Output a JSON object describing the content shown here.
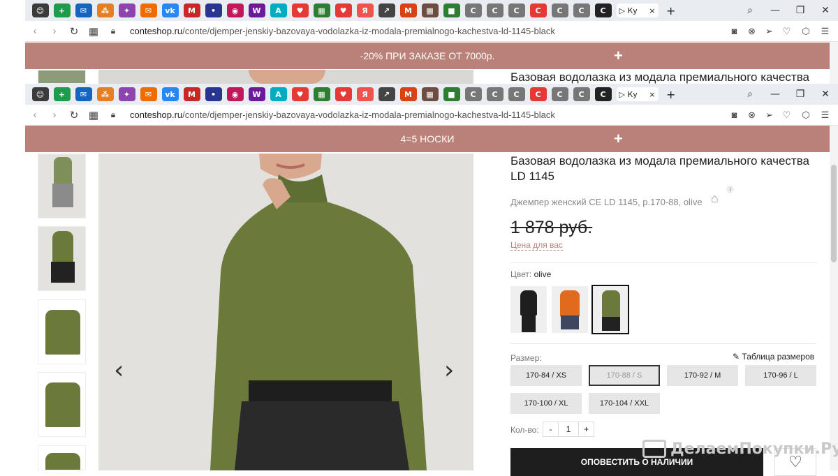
{
  "browser": {
    "active_tab_label": "▷ Ку",
    "close_tab": "×",
    "new_tab": "+",
    "url_domain": "conteshop.ru",
    "url_path": "/conte/djemper-jenskiy-bazovaya-vodolazka-iz-modala-premialnogo-kachestva-ld-1145-black",
    "tab_icons": [
      "😊",
      "+",
      "✉",
      "⁂",
      "✦",
      "✉",
      "vk",
      "M",
      "•",
      "◉",
      "W",
      "A",
      "♥",
      "▦",
      "♥",
      "Я",
      "↗",
      "M",
      "▦",
      "■",
      "C",
      "C",
      "C",
      "C",
      "C",
      "C",
      "C"
    ]
  },
  "promo_top": {
    "text": "-20% ПРИ ЗАКАЗЕ ОТ 7000р.",
    "plus": "+"
  },
  "promo_main": {
    "text": "4=5 НОСКИ",
    "plus": "+"
  },
  "product": {
    "title": "Базовая водолазка из модала премиального качества LD 1145",
    "subtitle": "Джемпер женский CE LD 1145, р.170-88, olive",
    "info_badge": "i",
    "old_price": "1 878 руб.",
    "price_for_you": "Цена для вас",
    "color_label": "Цвет:",
    "color_value": "olive",
    "size_label": "Размер:",
    "size_table": "Таблица размеров",
    "sizes": [
      "170-84 / XS",
      "170-88 / S",
      "170-92 / M",
      "170-96 / L",
      "170-100 / XL",
      "170-104 / XXL"
    ],
    "qty_label": "Кол-во:",
    "qty_minus": "-",
    "qty_value": "1",
    "qty_plus": "+",
    "notify_button": "ОПОВЕСТИТЬ О НАЛИЧИИ"
  },
  "gallery": {
    "prev": "‹",
    "next": "›"
  },
  "watermark": "ДелаемПокупки.Ру",
  "colors": {
    "promo": "#b98178",
    "olive": "#6b7a3a",
    "black_btn": "#1e1e1e"
  }
}
